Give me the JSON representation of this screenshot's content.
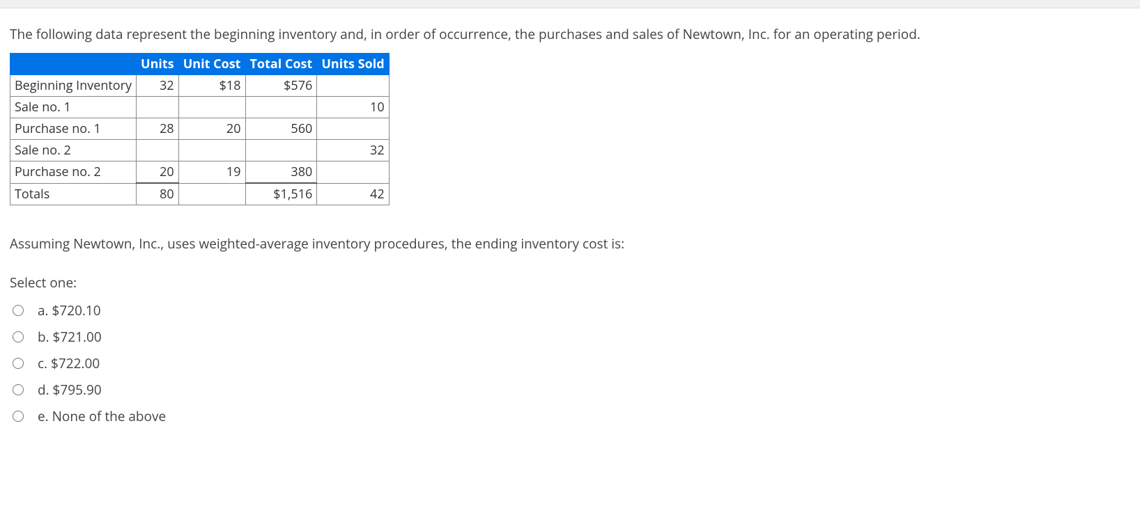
{
  "intro": "The following data represent the beginning inventory and, in order of occurrence, the purchases and sales of Newtown, Inc. for an operating period.",
  "table": {
    "headers": {
      "units": "Units",
      "unit_cost": "Unit Cost",
      "total_cost": "Total Cost",
      "units_sold": "Units Sold"
    },
    "rows": [
      {
        "label": "Beginning Inventory",
        "units": "32",
        "unit_cost": "$18",
        "total_cost": "$576",
        "units_sold": ""
      },
      {
        "label": "Sale no. 1",
        "units": "",
        "unit_cost": "",
        "total_cost": "",
        "units_sold": "10"
      },
      {
        "label": "Purchase no. 1",
        "units": "28",
        "unit_cost": "20",
        "total_cost": "560",
        "units_sold": ""
      },
      {
        "label": "Sale no. 2",
        "units": "",
        "unit_cost": "",
        "total_cost": "",
        "units_sold": "32"
      },
      {
        "label": "Purchase no. 2",
        "units": "20",
        "unit_cost": "19",
        "total_cost": "380",
        "units_sold": ""
      },
      {
        "label": "Totals",
        "units": "80",
        "unit_cost": "",
        "total_cost": "$1,516",
        "units_sold": "42"
      }
    ]
  },
  "question": "Assuming Newtown, Inc., uses weighted-average inventory procedures, the ending inventory cost is:",
  "select_label": "Select one:",
  "options": [
    {
      "key": "a",
      "text": "a. $720.10"
    },
    {
      "key": "b",
      "text": "b. $721.00"
    },
    {
      "key": "c",
      "text": "c. $722.00"
    },
    {
      "key": "d",
      "text": "d. $795.90"
    },
    {
      "key": "e",
      "text": "e. None of the above"
    }
  ]
}
